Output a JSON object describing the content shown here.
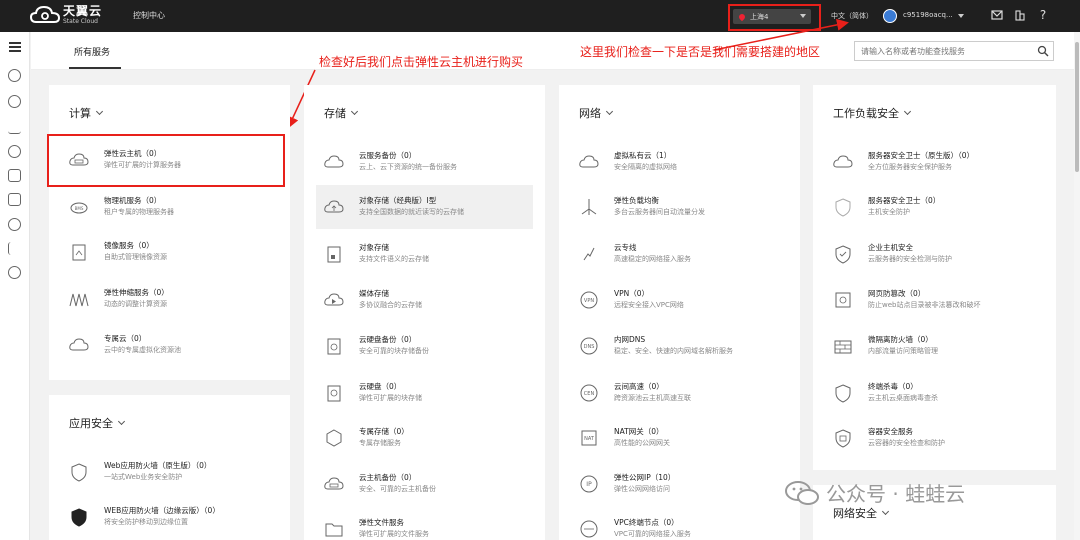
{
  "topbar": {
    "logo_name": "天翼云",
    "logo_sub": "State Cloud",
    "console": "控制中心",
    "region": "上海4",
    "lang": "中文（简体）",
    "user": "c95198oacq..."
  },
  "header": {
    "tab": "所有服务",
    "search_placeholder": "请输入名称或者功能查找服务"
  },
  "annotations": {
    "region_note": "这里我们检查一下是否是我们需要搭建的地区",
    "buy_note": "检查好后我们点击弹性云主机进行购买"
  },
  "cards": {
    "compute": {
      "title": "计算",
      "items": [
        {
          "name": "弹性云主机（0）",
          "desc": "弹性可扩展的计算服务器"
        },
        {
          "name": "物理机服务（0）",
          "desc": "租户专属的物理服务器"
        },
        {
          "name": "镜像服务（0）",
          "desc": "自助式管理镜像资源"
        },
        {
          "name": "弹性伸缩服务（0）",
          "desc": "动态的调整计算资源"
        },
        {
          "name": "专属云（0）",
          "desc": "云中的专属虚拟化资源池"
        }
      ]
    },
    "appsec": {
      "title": "应用安全",
      "items": [
        {
          "name": "Web应用防火墙（原生版）（0）",
          "desc": "一站式Web业务安全防护"
        },
        {
          "name": "WEB应用防火墙（边缘云版）（0）",
          "desc": "将安全防护移动到边缘位置"
        }
      ]
    },
    "storage": {
      "title": "存储",
      "items": [
        {
          "name": "云服务备份（0）",
          "desc": "云上、云下资源的统一备份服务"
        },
        {
          "name": "对象存储（经典版）Ⅰ型",
          "desc": "支持全国数据的就近读写的云存储"
        },
        {
          "name": "对象存储",
          "desc": "支持文件语义的云存储"
        },
        {
          "name": "媒体存储",
          "desc": "多协议融合的云存储"
        },
        {
          "name": "云硬盘备份（0）",
          "desc": "安全可靠的块存储备份"
        },
        {
          "name": "云硬盘（0）",
          "desc": "弹性可扩展的块存储"
        },
        {
          "name": "专属存储（0）",
          "desc": "专属存储服务"
        },
        {
          "name": "云主机备份（0）",
          "desc": "安全、可靠的云主机备份"
        },
        {
          "name": "弹性文件服务",
          "desc": "弹性可扩展的文件服务"
        }
      ]
    },
    "network": {
      "title": "网络",
      "items": [
        {
          "name": "虚拟私有云（1）",
          "desc": "安全隔离的虚拟网络"
        },
        {
          "name": "弹性负载均衡",
          "desc": "多台云服务器间自动流量分发"
        },
        {
          "name": "云专线",
          "desc": "高速稳定的网络接入服务"
        },
        {
          "name": "VPN（0）",
          "desc": "远程安全接入VPC网络"
        },
        {
          "name": "内网DNS",
          "desc": "稳定、安全、快速的内网域名解析服务"
        },
        {
          "name": "云间高速（0）",
          "desc": "跨资源池云主机高速互联"
        },
        {
          "name": "NAT网关（0）",
          "desc": "高性能的公网网关"
        },
        {
          "name": "弹性公网IP（10）",
          "desc": "弹性公网网络访问"
        },
        {
          "name": "VPC终端节点（0）",
          "desc": "VPC可靠的网络接入服务"
        }
      ]
    },
    "worksec": {
      "title": "工作负载安全",
      "items": [
        {
          "name": "服务器安全卫士（原生版）（0）",
          "desc": "全方位服务器安全保护服务"
        },
        {
          "name": "服务器安全卫士（0）",
          "desc": "主机安全防护"
        },
        {
          "name": "企业主机安全",
          "desc": "云服务器的安全检测与防护"
        },
        {
          "name": "网页防篡改（0）",
          "desc": "防止web站点目录被非法篡改和破坏"
        },
        {
          "name": "微隔离防火墙（0）",
          "desc": "内部流量访问策略管理"
        },
        {
          "name": "终端杀毒（0）",
          "desc": "云主机云桌面病毒查杀"
        },
        {
          "name": "容器安全服务",
          "desc": "云容器的安全检查和防护"
        }
      ]
    },
    "netsec": {
      "title": "网络安全"
    }
  },
  "watermark": "公众号 · 蛙蛙云"
}
